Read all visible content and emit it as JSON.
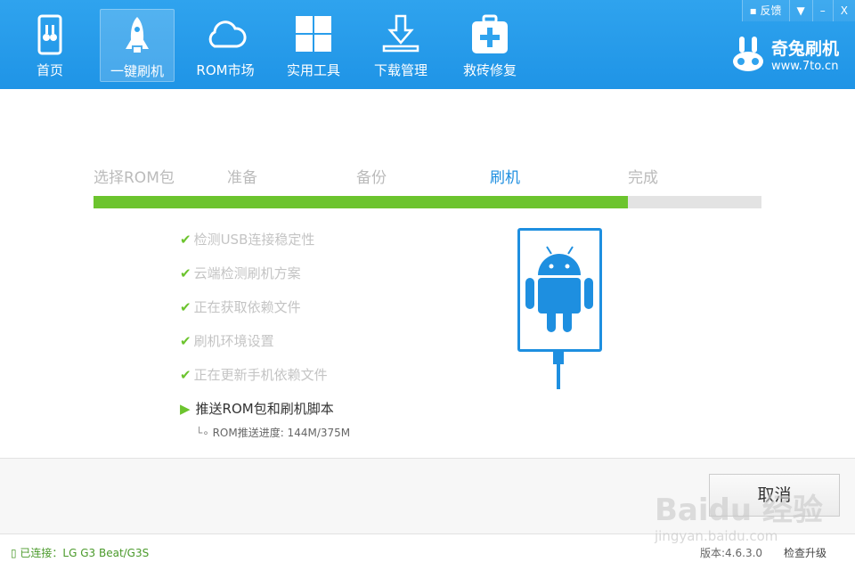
{
  "nav": [
    {
      "label": "首页",
      "icon": "phone-rabbit-icon"
    },
    {
      "label": "一键刷机",
      "icon": "rocket-icon",
      "active": true
    },
    {
      "label": "ROM市场",
      "icon": "cloud-icon"
    },
    {
      "label": "实用工具",
      "icon": "windows-grid-icon"
    },
    {
      "label": "下载管理",
      "icon": "download-icon"
    },
    {
      "label": "救砖修复",
      "icon": "first-aid-icon"
    }
  ],
  "window": {
    "feedback": "反馈",
    "menu": "▼",
    "minimize": "–",
    "close": "X"
  },
  "brand": {
    "name": "奇兔刷机",
    "url": "www.7to.cn"
  },
  "steps": [
    "选择ROM包",
    "准备",
    "备份",
    "刷机",
    "完成"
  ],
  "active_step": "刷机",
  "progress_percent": 80,
  "tasks": [
    "检测USB连接稳定性",
    "云端检测刷机方案",
    "正在获取依赖文件",
    "刷机环境设置",
    "正在更新手机依赖文件"
  ],
  "current_task": "推送ROM包和刷机脚本",
  "sub_status": "ROM推送进度: 144M/375M",
  "cancel": "取消",
  "status": {
    "connected": "已连接：LG G3 Beat/G3S",
    "version": "版本:4.6.3.0",
    "check_update": "检查升级"
  },
  "watermark": {
    "text": "Bai du 经验",
    "url": "jingyan.baidu.com"
  },
  "colors": {
    "accent": "#1f94e6",
    "success": "#6cc42e"
  }
}
